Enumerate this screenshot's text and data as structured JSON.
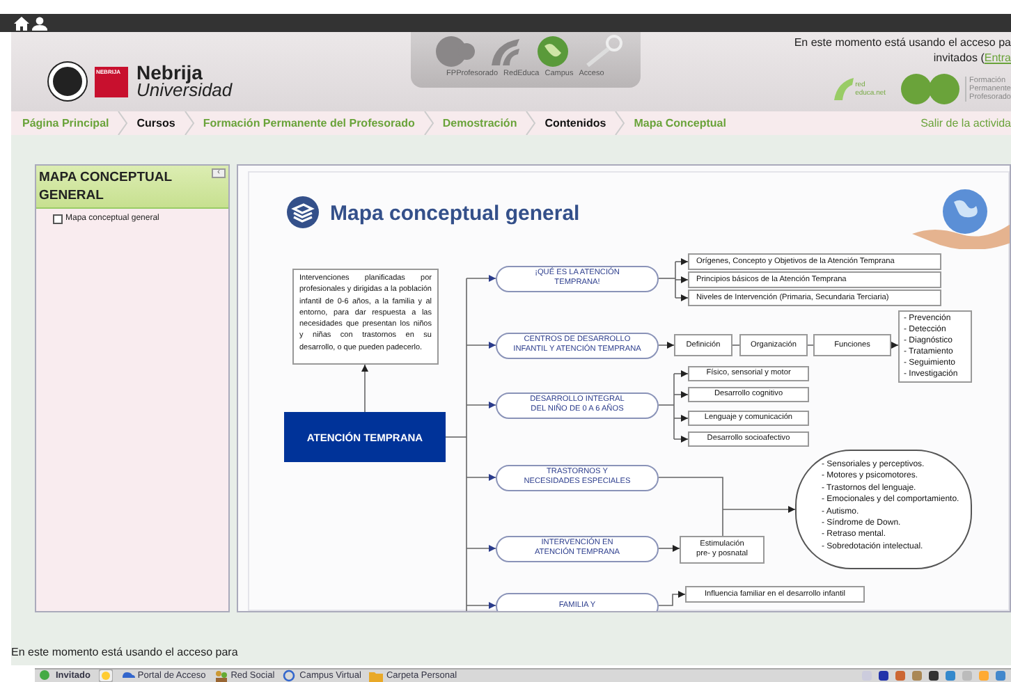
{
  "header": {
    "logo": {
      "badge": "NEBRIJA",
      "name": "Nebrija",
      "subtitle": "Universidad"
    },
    "portal_nav": [
      "FPProfesorado",
      "RedEduca",
      "Campus",
      "Acceso"
    ],
    "access_notice": {
      "line1": "En este momento está usando el acceso pa",
      "line2": "invitados (",
      "link": "Entra"
    },
    "rededuca_logo": [
      "red",
      "educa.net"
    ],
    "fpp_logo": [
      "Formación",
      "Permanente",
      "Profesorado"
    ]
  },
  "breadcrumb": [
    {
      "label": "Página Principal",
      "link": true
    },
    {
      "label": "Cursos",
      "link": false
    },
    {
      "label": "Formación Permanente del Profesorado",
      "link": true
    },
    {
      "label": "Demostración",
      "link": true
    },
    {
      "label": "Contenidos",
      "link": false
    },
    {
      "label": "Mapa Conceptual",
      "link": true
    }
  ],
  "exit_link": "Salir de la activida",
  "sidebar": {
    "title": "MAPA CONCEPTUAL GENERAL",
    "collapse_glyph": "‹",
    "items": [
      {
        "label": "Mapa conceptual general",
        "checked": false
      }
    ]
  },
  "map": {
    "title": "Mapa conceptual general",
    "root": "ATENCIÓN TEMPRANA",
    "definition": "Intervenciones planificadas por profesionales y dirigidas a la población infantil de 0-6 años, a la familia y al entorno, para dar respuesta a las necesidades que presentan los niños y niñas con trastornos en su desarrollo, o que pueden padecerlo.",
    "branches": [
      {
        "label": "¡QUÉ ES LA ATENCIÓN\nTEMPRANA!",
        "kind": "list",
        "children": [
          "Orígenes, Concepto y Objetivos de la Atención Temprana",
          "Principios básicos de la Atención Temprana",
          "Niveles de Intervención (Primaria, Secundaria Terciaria)"
        ]
      },
      {
        "label": "CENTROS DE DESARROLLO\nINFANTIL Y ATENCIÓN TEMPRANA",
        "kind": "chain",
        "children": [
          "Definición",
          "Organización",
          "Funciones"
        ],
        "outcome": [
          "- Prevención",
          "- Detección",
          "- Diagnóstico",
          "- Tratamiento",
          "- Seguimiento",
          "- Investigación"
        ]
      },
      {
        "label": "DESARROLLO INTEGRAL\nDEL NIÑO DE 0 A 6 AÑOS",
        "kind": "list",
        "children": [
          "Físico, sensorial y motor",
          "Desarrollo cognitivo",
          "Lenguaje y comunicación",
          "Desarrollo socioafectivo"
        ]
      },
      {
        "label": "TRASTORNOS Y\nNECESIDADES ESPECIALES",
        "kind": "merge"
      },
      {
        "label": "INTERVENCIÓN EN\nATENCIÓN TEMPRANA",
        "kind": "merge",
        "children": [
          "Estimulación\npre- y posnatal"
        ]
      },
      {
        "label": "FAMILIA Y",
        "kind": "list",
        "children": [
          "Influencia familiar en el desarrollo infantil"
        ]
      }
    ],
    "disorders": [
      "- Sensoriales y perceptivos.",
      "- Motores y psicomotores.",
      "- Trastornos del lenguaje.",
      "- Emocionales y del comportamiento.",
      "- Autismo.",
      "- Síndrome de Down.",
      "- Retraso mental.",
      "- Sobredotación intelectual."
    ]
  },
  "footer_notice": "En este momento está usando el acceso para",
  "taskbar": [
    "Invitado",
    "Portal de Acceso",
    "Red Social",
    "Campus Virtual",
    "Carpeta Personal"
  ]
}
